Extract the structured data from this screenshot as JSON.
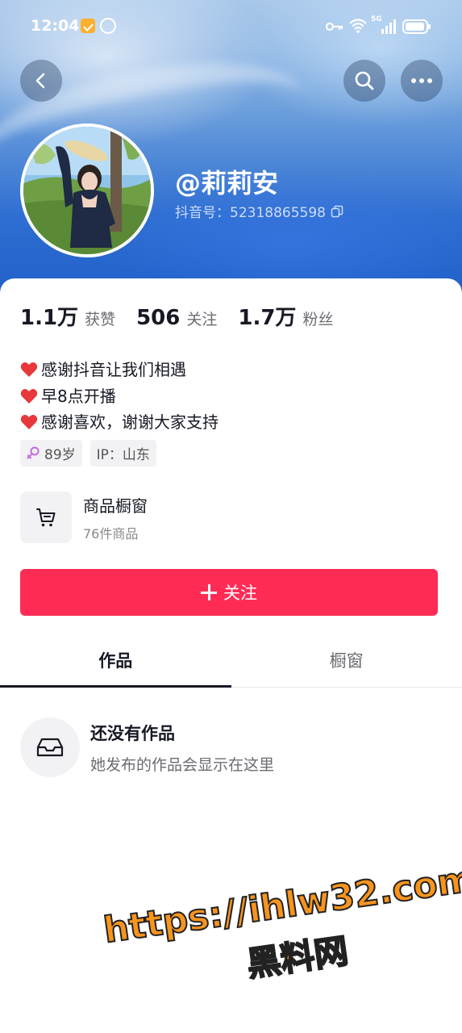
{
  "status_bar": {
    "time": "12:04",
    "network": "5G"
  },
  "header": {
    "back_icon": "chevron-left-icon",
    "search_icon": "search-icon",
    "more_icon": "more-horizontal-icon"
  },
  "profile": {
    "username": "@莉莉安",
    "douyin_id": "抖音号：52318865598"
  },
  "stats": [
    {
      "value": "1.1万",
      "label": "获赞"
    },
    {
      "value": "506",
      "label": "关注"
    },
    {
      "value": "1.7万",
      "label": "粉丝"
    }
  ],
  "bio": {
    "lines": [
      "感谢抖音让我们相遇",
      "早8点开播",
      "感谢喜欢，谢谢大家支持"
    ]
  },
  "tags": {
    "age": "89岁",
    "ip": "IP：山东"
  },
  "shop": {
    "title": "商品橱窗",
    "subtitle": "76件商品"
  },
  "follow_button": {
    "label": "关注"
  },
  "tabs": [
    {
      "label": "作品",
      "active": true
    },
    {
      "label": "橱窗",
      "active": false
    }
  ],
  "empty_state": {
    "title": "还没有作品",
    "subtitle": "她发布的作品会显示在这里"
  },
  "watermark": {
    "url": "https://ihlw32.com",
    "name": "黑料网"
  },
  "colors": {
    "accent": "#fe2c55",
    "text_primary": "#161823",
    "text_secondary": "#6b6c72"
  }
}
